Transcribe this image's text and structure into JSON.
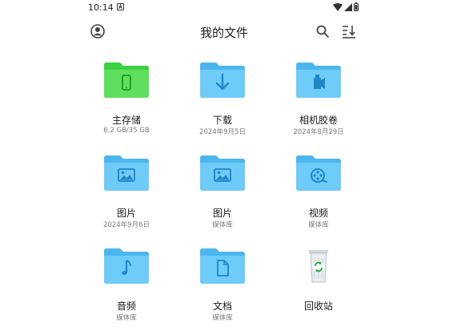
{
  "status_bar": {
    "time": "10:14"
  },
  "header": {
    "title": "我的文件"
  },
  "colors": {
    "folder_blue": "#59c2f5",
    "folder_green": "#3fd03f",
    "folder_glyph": "#1f86c7"
  },
  "items": [
    {
      "label": "主存储",
      "sub": "6.2 GB/35 GB",
      "icon": "phone-icon"
    },
    {
      "label": "下载",
      "sub": "2024年9月5日",
      "icon": "download-arrow-icon"
    },
    {
      "label": "相机胶卷",
      "sub": "2024年8月29日",
      "icon": "camera-icon"
    },
    {
      "label": "图片",
      "sub": "2024年9月6日",
      "icon": "image-icon"
    },
    {
      "label": "图片",
      "sub": "媒体库",
      "icon": "image-icon"
    },
    {
      "label": "视频",
      "sub": "媒体库",
      "icon": "film-reel-icon"
    },
    {
      "label": "音频",
      "sub": "媒体库",
      "icon": "music-note-icon"
    },
    {
      "label": "文档",
      "sub": "媒体库",
      "icon": "document-icon"
    },
    {
      "label": "回收站",
      "sub": "",
      "icon": "recycle-bin-icon"
    }
  ]
}
